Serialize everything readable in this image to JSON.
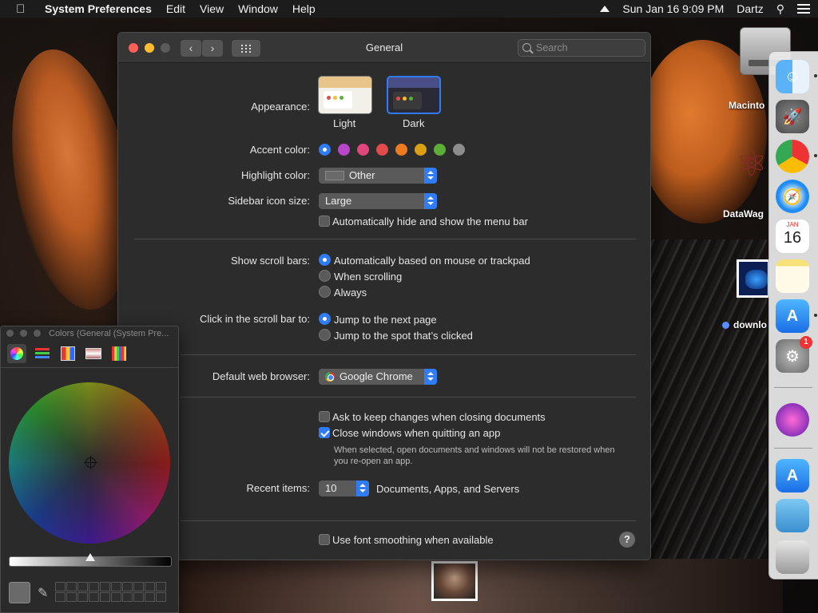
{
  "menubar": {
    "app_name": "System Preferences",
    "menus": [
      "Edit",
      "View",
      "Window",
      "Help"
    ],
    "clock": "Sun Jan 16  9:09 PM",
    "user": "Dartz"
  },
  "desktop": {
    "hd_label": "Macinto",
    "atom_label": "DataWag",
    "download_label": "downlo"
  },
  "dock": {
    "items": [
      {
        "name": "finder-icon",
        "glyph": "☺"
      },
      {
        "name": "launchpad-icon",
        "glyph": "🚀"
      },
      {
        "name": "chrome-icon",
        "glyph": ""
      },
      {
        "name": "safari-icon",
        "glyph": "🧭"
      },
      {
        "name": "calendar-icon",
        "month": "JAN",
        "day": "16"
      },
      {
        "name": "notes-icon",
        "glyph": ""
      },
      {
        "name": "app-store-icon",
        "glyph": "A"
      },
      {
        "name": "system-preferences-icon",
        "glyph": "⚙",
        "badge": "1"
      },
      {
        "name": "installer-icon",
        "glyph": ""
      },
      {
        "name": "app-store-downloads-icon",
        "glyph": "A"
      },
      {
        "name": "downloads-folder-icon",
        "glyph": ""
      },
      {
        "name": "trash-icon",
        "glyph": ""
      }
    ]
  },
  "window": {
    "title": "General",
    "search_placeholder": "Search"
  },
  "appearance": {
    "label": "Appearance:",
    "options": [
      "Light",
      "Dark"
    ],
    "selected": "Dark"
  },
  "accent": {
    "label": "Accent color:",
    "colors": [
      "#2f7cf6",
      "#b946c8",
      "#e0457b",
      "#e34a4a",
      "#ee7a1f",
      "#d9a014",
      "#5cae39",
      "#8c8c8c"
    ]
  },
  "highlight": {
    "label": "Highlight color:",
    "value": "Other"
  },
  "sidebar_size": {
    "label": "Sidebar icon size:",
    "value": "Large"
  },
  "menu_bar_hide": {
    "label": "Automatically hide and show the menu bar",
    "checked": false
  },
  "scroll_bars": {
    "label": "Show scroll bars:",
    "options": [
      "Automatically based on mouse or trackpad",
      "When scrolling",
      "Always"
    ],
    "selected": 0
  },
  "scroll_click": {
    "label": "Click in the scroll bar to:",
    "options": [
      "Jump to the next page",
      "Jump to the spot that’s clicked"
    ],
    "selected": 0
  },
  "browser": {
    "label": "Default web browser:",
    "value": "Google Chrome"
  },
  "docs": {
    "ask_keep": "Ask to keep changes when closing documents",
    "close_windows": "Close windows when quitting an app",
    "hint": "When selected, open documents and windows will not be restored when you re-open an app."
  },
  "recent": {
    "label": "Recent items:",
    "value": "10",
    "suffix": "Documents, Apps, and Servers"
  },
  "font_smoothing": {
    "label": "Use font smoothing when available"
  },
  "help_glyph": "?",
  "colors_panel": {
    "title": "Colors (General (System Pre..."
  }
}
